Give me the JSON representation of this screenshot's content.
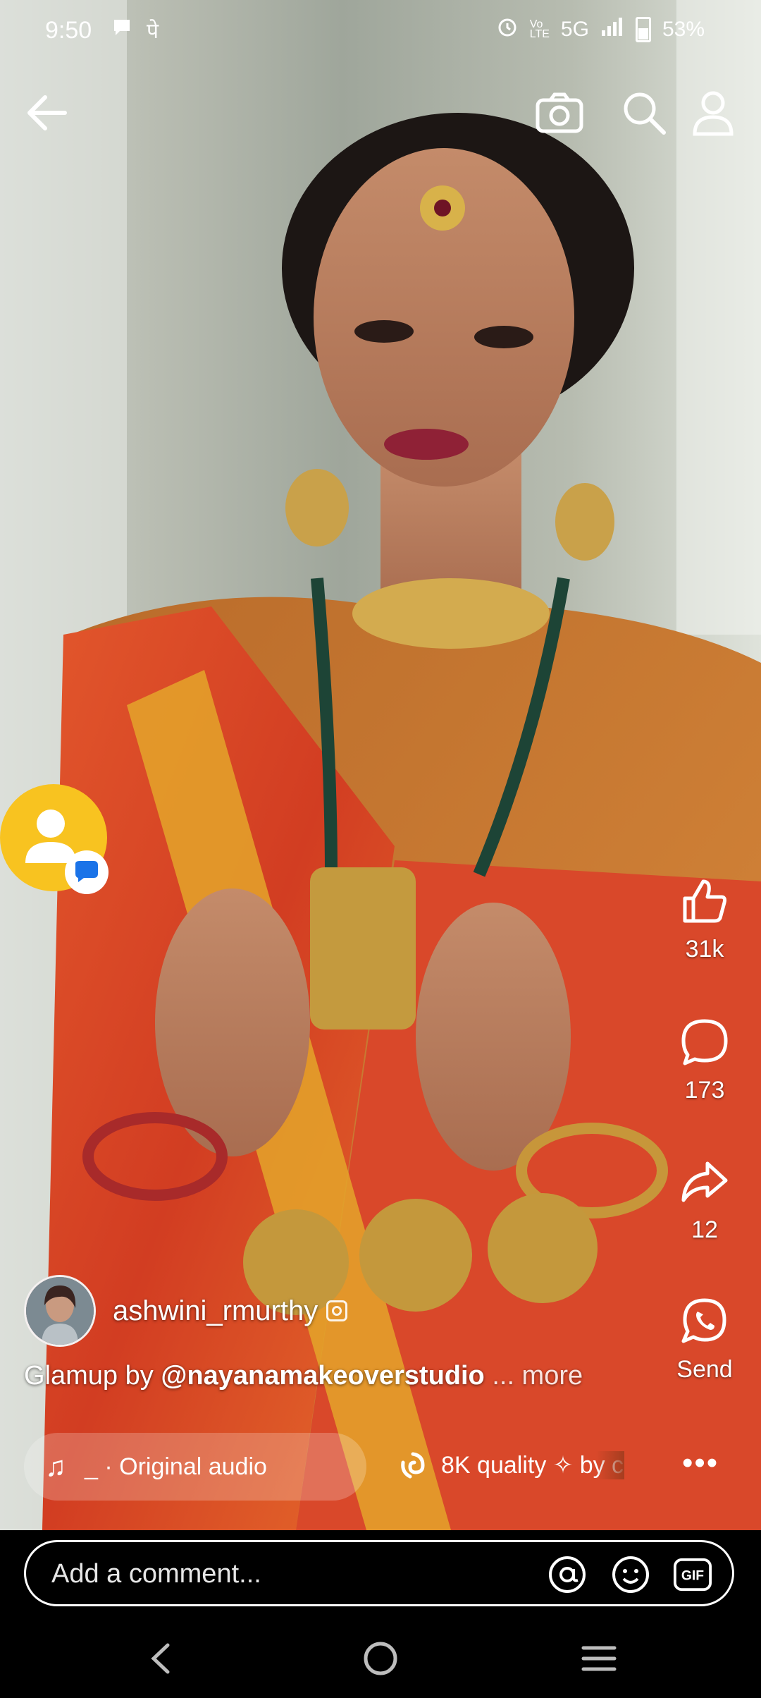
{
  "status_bar": {
    "time": "9:50",
    "app_glyph": "पे",
    "network": "5G",
    "battery": "53%"
  },
  "top_bar": {
    "icons": [
      "back-arrow-icon",
      "camera-icon",
      "search-icon",
      "profile-icon"
    ]
  },
  "reel": {
    "author": {
      "username": "ashwini_rmurthy"
    },
    "caption": {
      "prefix": "Glamup by ",
      "mention": "@nayanamakeoverstudio",
      "more": " ... more"
    },
    "audio": {
      "label": "_ · Original audio"
    },
    "effect": {
      "label": "8K quality ✧ by c"
    },
    "actions": [
      {
        "name": "like",
        "count": "31k"
      },
      {
        "name": "comment",
        "count": "173"
      },
      {
        "name": "share",
        "count": "12"
      },
      {
        "name": "send",
        "label": "Send"
      }
    ]
  },
  "comment_bar": {
    "placeholder": "Add a comment..."
  },
  "nav_bar": {
    "icons": [
      "nav-back-icon",
      "nav-home-icon",
      "nav-recents-icon"
    ]
  }
}
